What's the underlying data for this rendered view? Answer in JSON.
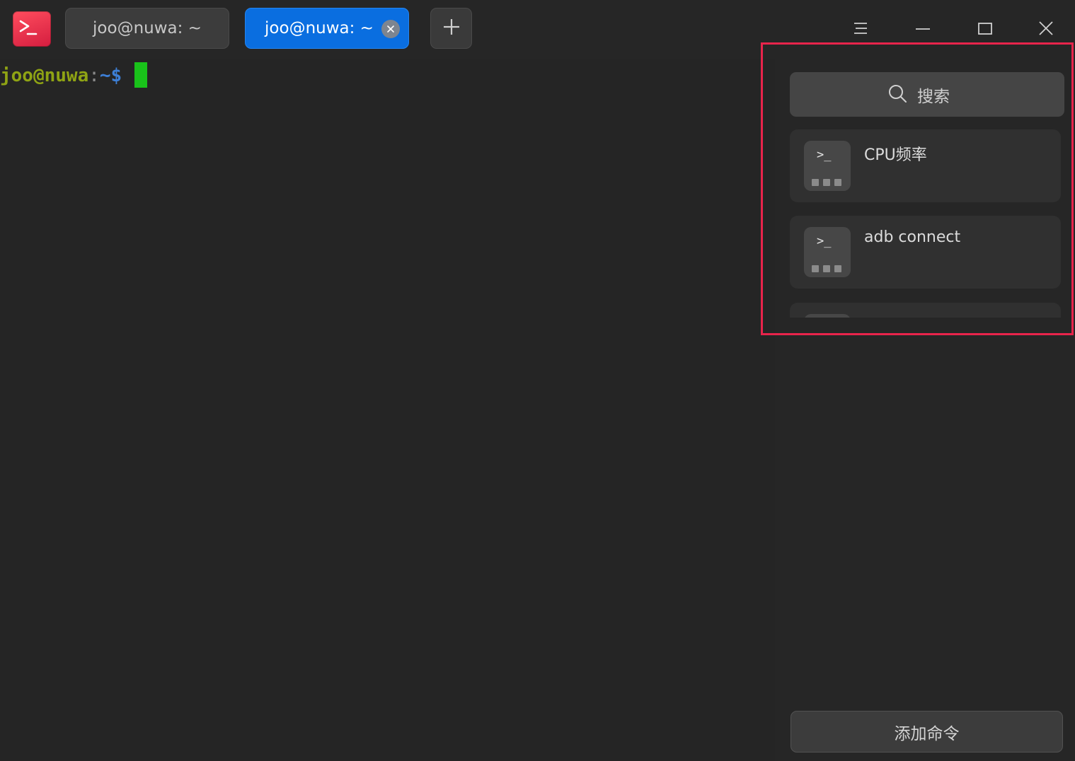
{
  "app": {
    "icon": "terminal-app-icon",
    "accent_color": "#0a6ee0"
  },
  "tabs": [
    {
      "label": "joo@nuwa: ~",
      "active": false
    },
    {
      "label": "joo@nuwa: ~",
      "active": true
    }
  ],
  "titlebar": {
    "new_tab_icon": "plus-icon",
    "menu_icon": "hamburger-menu-icon",
    "minimize_icon": "minimize-icon",
    "maximize_icon": "maximize-icon",
    "close_icon": "close-icon"
  },
  "terminal": {
    "user_host": "joo@nuwa",
    "colon": ":",
    "path": "~",
    "dollar": "$",
    "cursor_color": "#19c21a"
  },
  "panel": {
    "search": {
      "label": "搜索",
      "icon": "search-icon"
    },
    "commands": [
      {
        "name": "CPU频率",
        "icon": "command-icon"
      },
      {
        "name": "adb connect",
        "icon": "command-icon"
      },
      {
        "name": "",
        "icon": "command-icon"
      }
    ],
    "add_button_label": "添加命令",
    "highlight_color": "#e8244b"
  }
}
